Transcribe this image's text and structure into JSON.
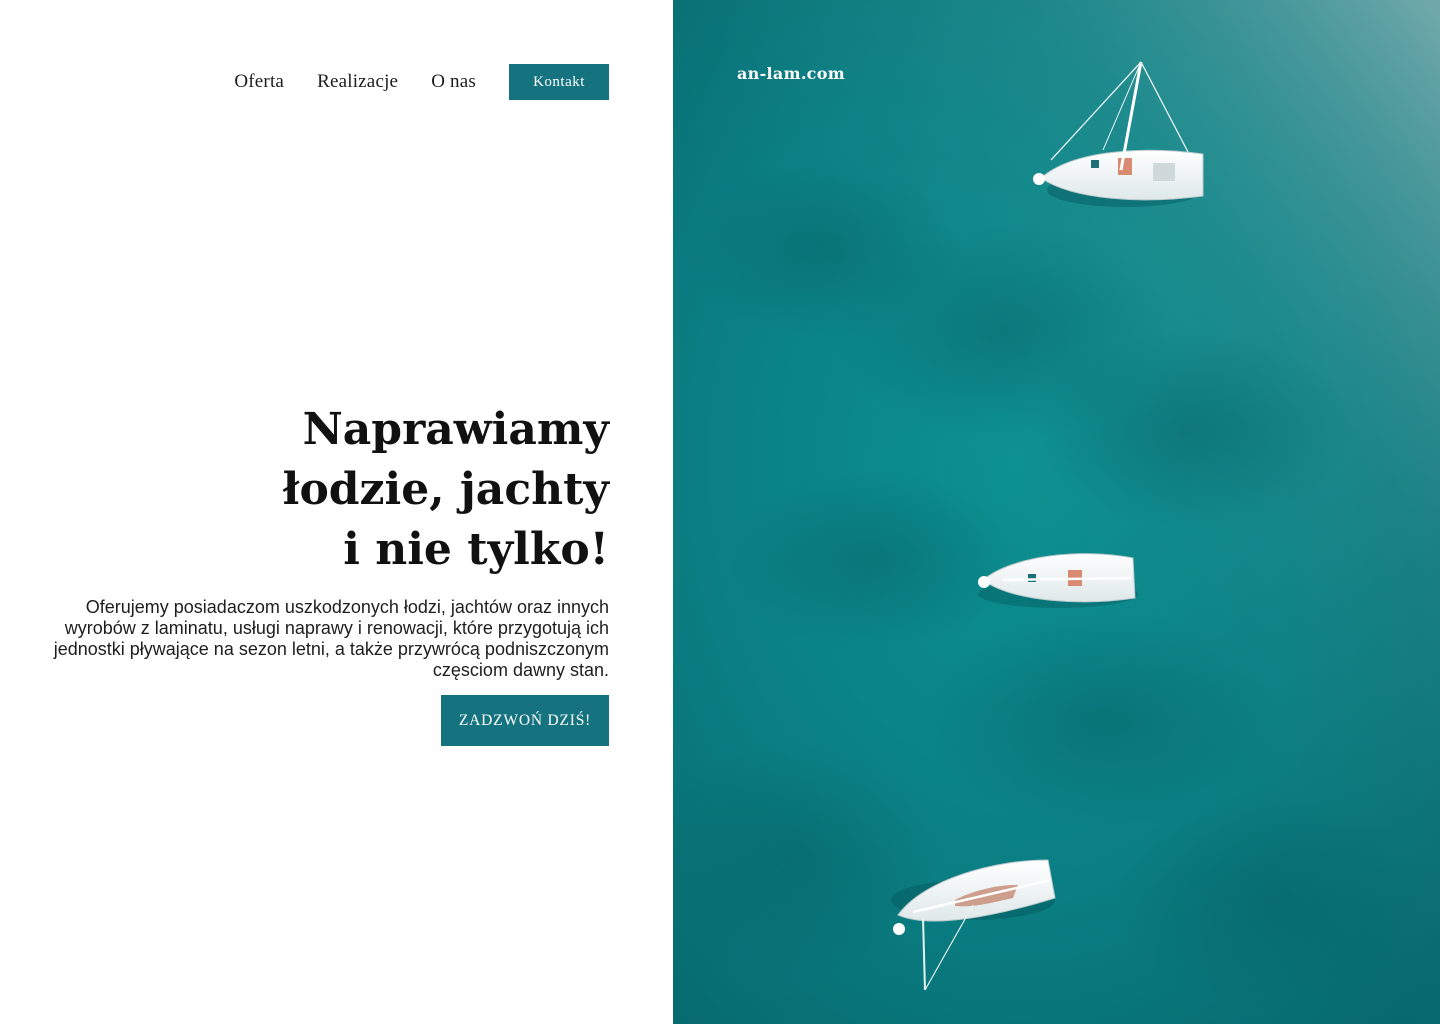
{
  "nav": {
    "items": [
      {
        "label": "Oferta"
      },
      {
        "label": "Realizacje"
      },
      {
        "label": "O nas"
      }
    ],
    "contact_label": "Kontakt"
  },
  "hero": {
    "title_lines": [
      "Naprawiamy",
      "łodzie, jachty",
      "i nie tylko!"
    ],
    "description": "Oferujemy posiadaczom uszkodzonych łodzi, jachtów oraz innych wyrobów z laminatu, usługi naprawy i renowacji, które przygotują ich jednostki pływające na sezon letni, a także przywrócą podniszczonym częsciom dawny stan.",
    "cta_label": "ZADZWOŃ DZIŚ!"
  },
  "brand": {
    "logo_text": "an-lam.com"
  },
  "colors": {
    "accent": "#14737f",
    "sea": "#0e8a8c",
    "text": "#111111",
    "background": "#ffffff"
  }
}
